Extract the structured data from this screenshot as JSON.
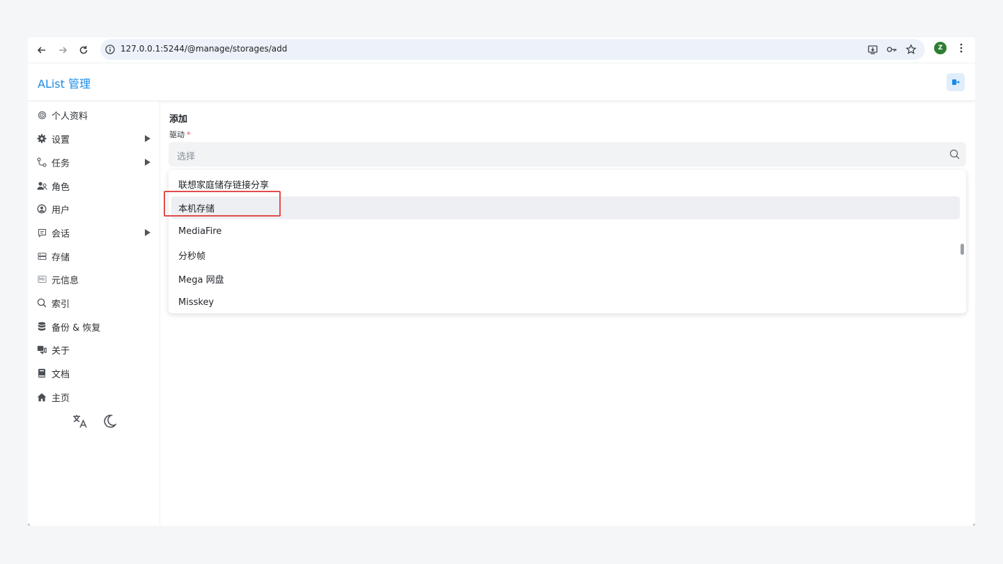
{
  "browser": {
    "url": "127.0.0.1:5244/@manage/storages/add",
    "profile_initial": "Z"
  },
  "header": {
    "title": "AList 管理"
  },
  "sidebar": {
    "items": [
      {
        "label": "个人资料",
        "icon": "fingerprint-icon",
        "has_arrow": false
      },
      {
        "label": "设置",
        "icon": "gear-icon",
        "has_arrow": true
      },
      {
        "label": "任务",
        "icon": "route-icon",
        "has_arrow": true
      },
      {
        "label": "角色",
        "icon": "users-icon",
        "has_arrow": false
      },
      {
        "label": "用户",
        "icon": "user-circle-icon",
        "has_arrow": false
      },
      {
        "label": "会话",
        "icon": "message-icon",
        "has_arrow": true
      },
      {
        "label": "存储",
        "icon": "database-icon",
        "has_arrow": false
      },
      {
        "label": "元信息",
        "icon": "meta-icon",
        "has_arrow": false
      },
      {
        "label": "索引",
        "icon": "search-icon",
        "has_arrow": false
      },
      {
        "label": "备份 & 恢复",
        "icon": "database-stack-icon",
        "has_arrow": false
      },
      {
        "label": "关于",
        "icon": "chat-bubbles-icon",
        "has_arrow": false
      },
      {
        "label": "文档",
        "icon": "book-icon",
        "has_arrow": false
      },
      {
        "label": "主页",
        "icon": "home-icon",
        "has_arrow": false
      }
    ]
  },
  "main": {
    "heading": "添加",
    "driver_label": "驱动",
    "required_mark": "*",
    "select_placeholder": "选择",
    "options": [
      "联想家庭储存链接分享",
      "本机存储",
      "MediaFire",
      "分秒帧",
      "Mega 网盘",
      "Misskey"
    ],
    "active_option_index": 1
  },
  "colors": {
    "accent": "#1a8be6",
    "highlight_box": "#e24b4b",
    "required": "#e5484d"
  }
}
